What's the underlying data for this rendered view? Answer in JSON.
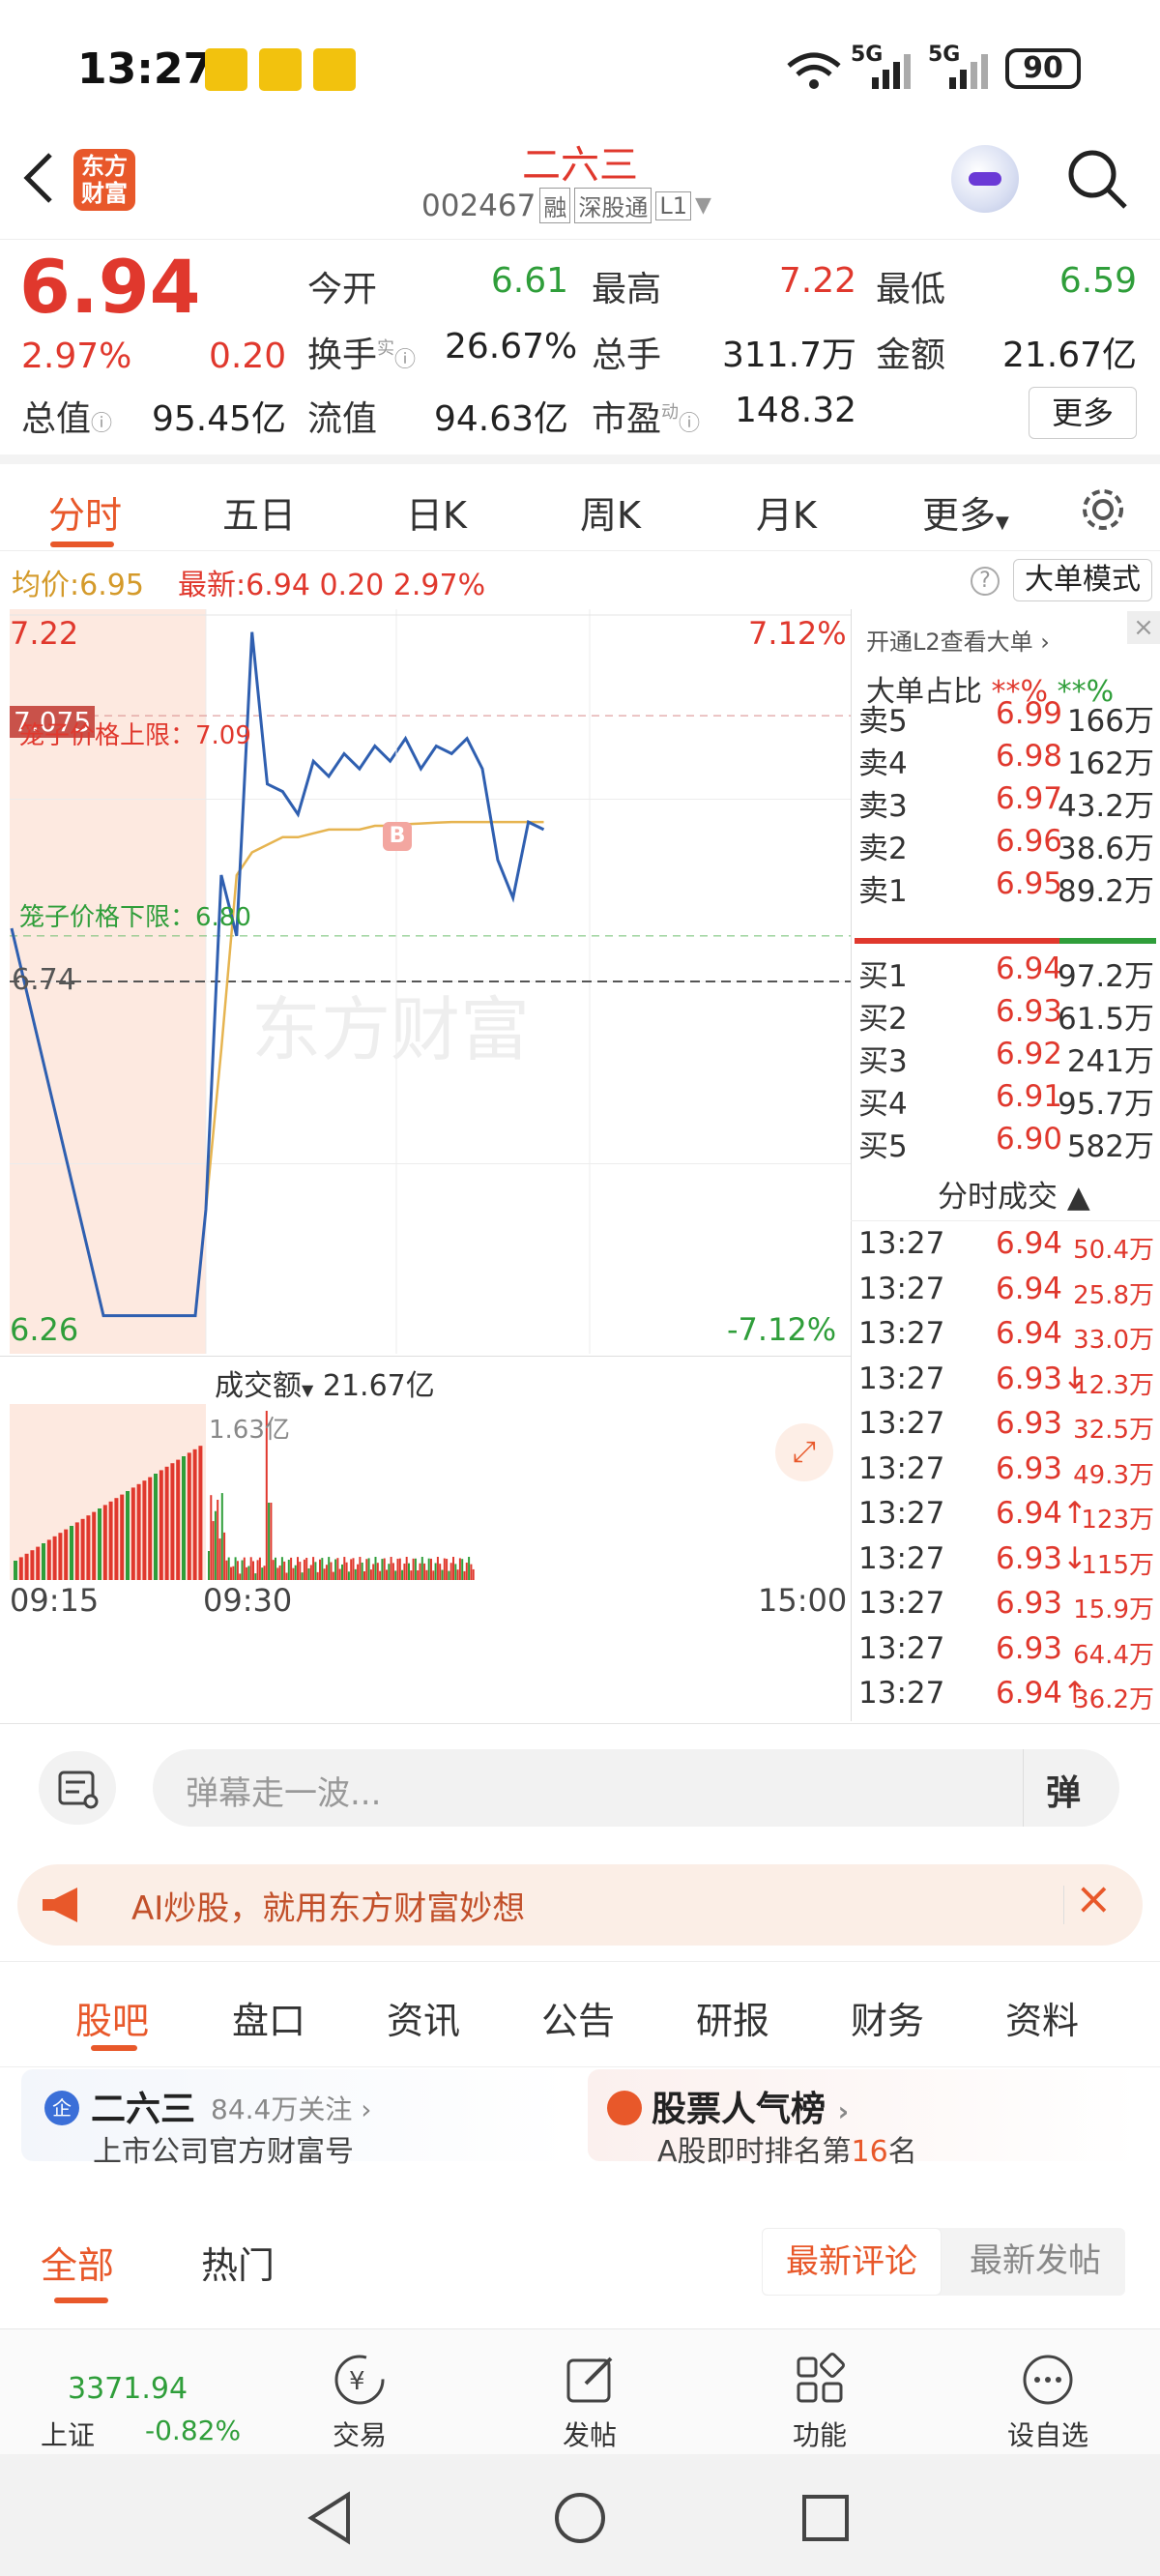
{
  "status_bar": {
    "time": "13:27",
    "mini_badge": "美团\n开店宝",
    "net1": "5G",
    "net2": "5G",
    "battery": "90"
  },
  "header": {
    "title": "二六三",
    "code": "002467",
    "tags": [
      "融",
      "深股通",
      "L1"
    ],
    "brand_line1": "东方",
    "brand_line2": "财富"
  },
  "quote": {
    "price": "6.94",
    "change_pct": "2.97%",
    "change": "0.20",
    "open_label": "今开",
    "open": "6.61",
    "high_label": "最高",
    "high": "7.22",
    "low_label": "最低",
    "low": "6.59",
    "turnover_label": "换手",
    "turnover_sup": "实",
    "turnover": "26.67%",
    "volume_label": "总手",
    "volume": "311.7万",
    "amount_label": "金额",
    "amount": "21.67亿",
    "mcap_label": "总值",
    "mcap": "95.45亿",
    "float_label": "流值",
    "float": "94.63亿",
    "pe_label": "市盈",
    "pe_sup": "动",
    "pe": "148.32",
    "more_button": "更多"
  },
  "tabs": [
    "分时",
    "五日",
    "日K",
    "周K",
    "月K",
    "更多"
  ],
  "chart": {
    "avg_label": "均价:",
    "avg": "6.95",
    "latest_label": "最新:",
    "latest": "6.94",
    "chg": "0.20",
    "chg_pct": "2.97%",
    "big_order_mode": "大单模式",
    "y_max": "7.22",
    "y_min": "6.26",
    "pct_max": "7.12%",
    "pct_min": "-7.12%",
    "upper_limit_label": "笼子价格上限：7.09",
    "lower_limit_label": "笼子价格下限：6.80",
    "prev_close": "6.74",
    "marker_price": "7.075",
    "watermark": "东方财富",
    "buy_marker": "B",
    "vol_selector": "成交额",
    "vol_total": "21.67亿",
    "vol_max": "1.63亿",
    "t_start": "09:15",
    "t_open": "09:30",
    "t_end": "15:00"
  },
  "chart_data": {
    "type": "line",
    "x": [
      "09:15",
      "09:20",
      "09:25",
      "09:30",
      "09:35",
      "09:40",
      "09:45",
      "09:50",
      "09:55",
      "10:00",
      "10:05",
      "10:10",
      "10:15",
      "10:20",
      "10:25",
      "10:30",
      "10:35",
      "10:40",
      "10:45",
      "10:50",
      "10:55",
      "11:00",
      "11:05",
      "11:10",
      "11:15",
      "11:20"
    ],
    "series": [
      {
        "values": [
          6.81,
          6.3,
          6.3,
          6.44,
          6.88,
          6.8,
          7.2,
          7.0,
          6.99,
          6.96,
          7.03,
          7.01,
          7.04,
          7.02,
          7.05,
          7.03,
          7.06,
          7.02,
          7.05,
          7.04,
          7.06,
          7.02,
          6.9,
          6.85,
          6.95,
          6.94
        ]
      },
      {
        "values": [
          null,
          null,
          null,
          6.44,
          6.65,
          6.88,
          6.91,
          6.92,
          6.93,
          6.93,
          6.935,
          6.94,
          6.94,
          6.94,
          6.945,
          6.945,
          6.947,
          6.948,
          6.949,
          6.95,
          6.95,
          6.95,
          6.95,
          6.95,
          6.95,
          6.95
        ]
      }
    ],
    "ylim": [
      6.26,
      7.22
    ],
    "prev_close": 6.74
  },
  "depth": {
    "promo": "开通L2查看大单",
    "ratio_label": "大单占比",
    "ratio_sell": "**%",
    "ratio_buy": "**%",
    "asks": [
      {
        "name": "卖5",
        "price": "6.99",
        "vol": "166万"
      },
      {
        "name": "卖4",
        "price": "6.98",
        "vol": "162万"
      },
      {
        "name": "卖3",
        "price": "6.97",
        "vol": "43.2万"
      },
      {
        "name": "卖2",
        "price": "6.96",
        "vol": "38.6万"
      },
      {
        "name": "卖1",
        "price": "6.95",
        "vol": "89.2万"
      }
    ],
    "bids": [
      {
        "name": "买1",
        "price": "6.94",
        "vol": "97.2万"
      },
      {
        "name": "买2",
        "price": "6.93",
        "vol": "61.5万"
      },
      {
        "name": "买3",
        "price": "6.92",
        "vol": "241万"
      },
      {
        "name": "买4",
        "price": "6.91",
        "vol": "95.7万"
      },
      {
        "name": "买5",
        "price": "6.90",
        "vol": "582万"
      }
    ],
    "ticks_title": "分时成交",
    "ticks": [
      {
        "t": "13:27",
        "p": "6.94",
        "v": "50.4万"
      },
      {
        "t": "13:27",
        "p": "6.94",
        "v": "25.8万"
      },
      {
        "t": "13:27",
        "p": "6.94",
        "v": "33.0万"
      },
      {
        "t": "13:27",
        "p": "6.93↓",
        "v": "12.3万"
      },
      {
        "t": "13:27",
        "p": "6.93",
        "v": "32.5万"
      },
      {
        "t": "13:27",
        "p": "6.93",
        "v": "49.3万"
      },
      {
        "t": "13:27",
        "p": "6.94↑",
        "v": "123万"
      },
      {
        "t": "13:27",
        "p": "6.93↓",
        "v": "115万"
      },
      {
        "t": "13:27",
        "p": "6.93",
        "v": "15.9万"
      },
      {
        "t": "13:27",
        "p": "6.93",
        "v": "64.4万"
      },
      {
        "t": "13:27",
        "p": "6.94↑",
        "v": "36.2万"
      }
    ]
  },
  "comment": {
    "placeholder": "弹幕走一波...",
    "danmu": "弹"
  },
  "ad": {
    "text": "AI炒股，就用东方财富妙想"
  },
  "section_tabs": [
    "股吧",
    "盘口",
    "资讯",
    "公告",
    "研报",
    "财务",
    "资料"
  ],
  "card_left": {
    "name": "二六三",
    "followers": "84.4万关注",
    "sub": "上市公司官方财富号",
    "badge": "企"
  },
  "card_right": {
    "title": "股票人气榜",
    "sub_prefix": "A股即时排名第",
    "rank": "16",
    "sub_suffix": "名"
  },
  "filter": {
    "all": "全部",
    "hot": "热门",
    "latest_comment": "最新评论",
    "latest_post": "最新发帖"
  },
  "bottom_nav": {
    "index_value": "3371.94",
    "index_name": "上证",
    "index_change": "-0.82%",
    "trade": "交易",
    "post": "发帖",
    "func": "功能",
    "watch": "设自选"
  },
  "colors": {
    "up": "#e0382d",
    "down": "#2f9e3a",
    "accent": "#e8582a",
    "line": "#2f5fb0",
    "avg": "#e6b450"
  }
}
